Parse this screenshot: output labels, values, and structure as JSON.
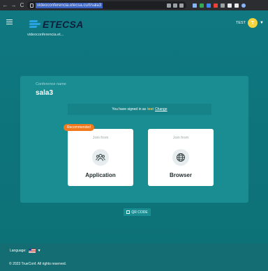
{
  "browser": {
    "url": "videoconferencia.etecsa.cu/t/sala3",
    "back": "←",
    "forward": "→",
    "reload": "C"
  },
  "header": {
    "brand": "ETECSA",
    "site": "videoconferencia.et...",
    "user_name": "TEST",
    "avatar_letter": "T"
  },
  "conference": {
    "label": "Conference name",
    "name": "sala3",
    "signed_text": "You have signed in as",
    "signed_user": "test",
    "change_label": "Change"
  },
  "cards": {
    "badge": "Recommended",
    "application": {
      "join": "Join from",
      "title": "Application"
    },
    "browser": {
      "join": "Join from",
      "title": "Browser"
    }
  },
  "qr_label": "QR CODE",
  "footer": {
    "language_label": "Language:",
    "copyright": "© 2023 TrueConf. All rights reserved."
  },
  "colors": {
    "accent": "#0f7a80",
    "badge": "#f0791e",
    "avatar": "#f5d33c"
  }
}
